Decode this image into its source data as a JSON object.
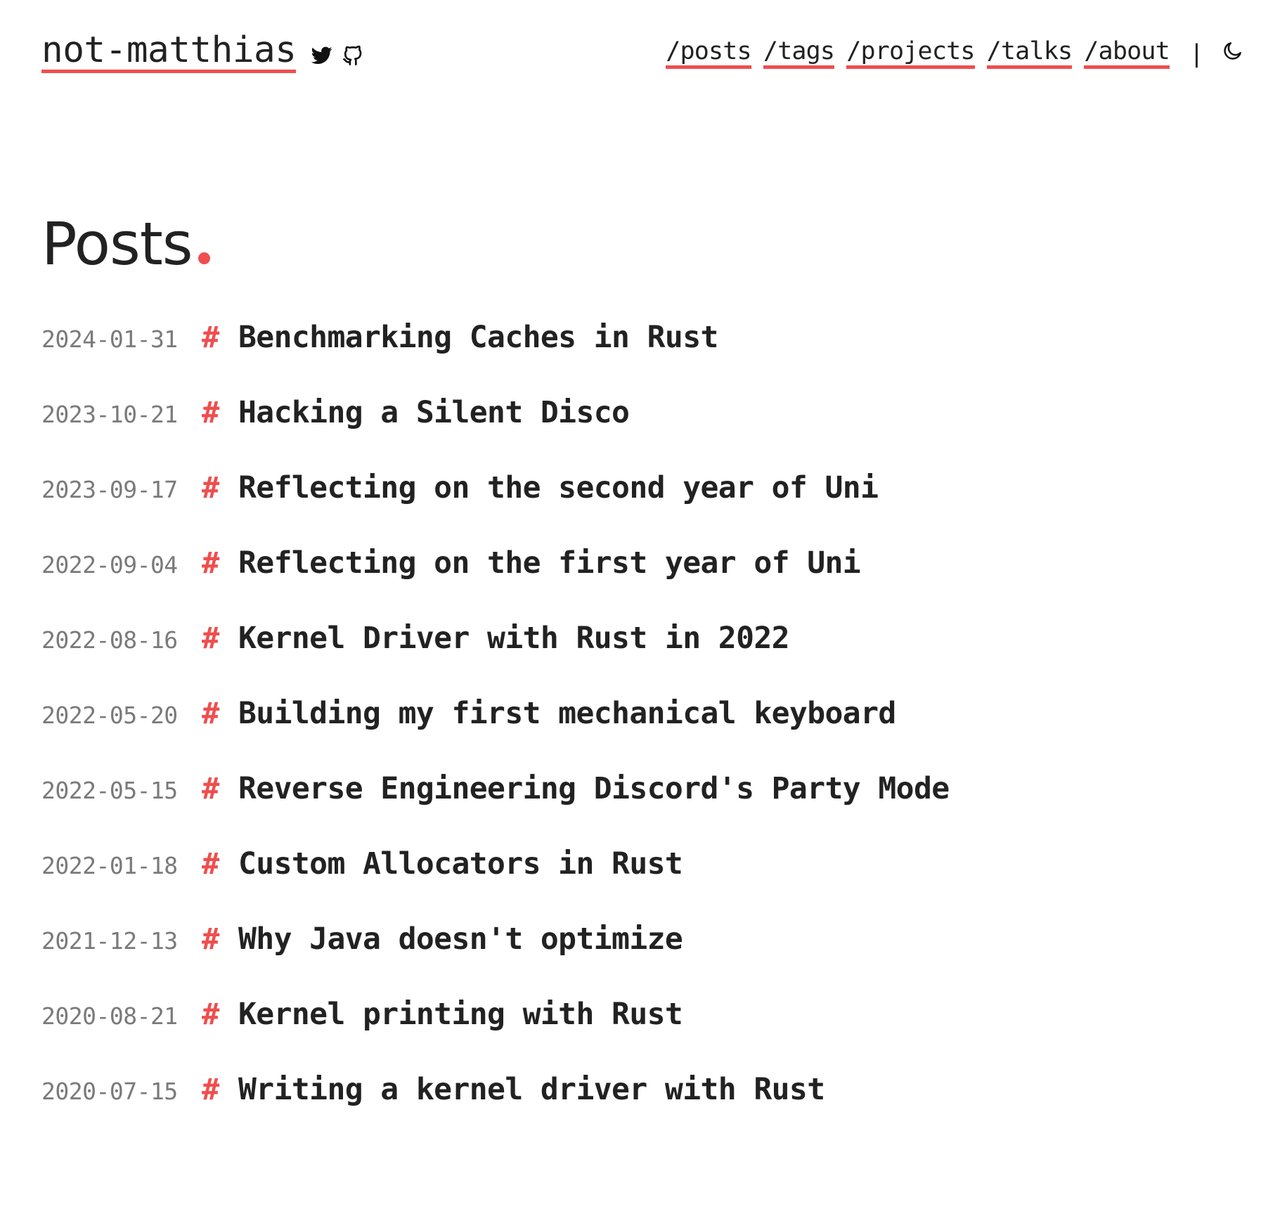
{
  "header": {
    "site_title": "not-matthias",
    "social": [
      {
        "icon": "twitter-icon"
      },
      {
        "icon": "github-icon"
      }
    ],
    "nav": [
      "/posts",
      "/tags",
      "/projects",
      "/talks",
      "/about"
    ],
    "separator": "|",
    "theme_toggle_icon": "moon-icon"
  },
  "main": {
    "heading": "Posts",
    "posts": [
      {
        "date": "2024-01-31",
        "hash": "#",
        "title": "Benchmarking Caches in Rust"
      },
      {
        "date": "2023-10-21",
        "hash": "#",
        "title": "Hacking a Silent Disco"
      },
      {
        "date": "2023-09-17",
        "hash": "#",
        "title": "Reflecting on the second year of Uni"
      },
      {
        "date": "2022-09-04",
        "hash": "#",
        "title": "Reflecting on the first year of Uni"
      },
      {
        "date": "2022-08-16",
        "hash": "#",
        "title": "Kernel Driver with Rust in 2022"
      },
      {
        "date": "2022-05-20",
        "hash": "#",
        "title": "Building my first mechanical keyboard"
      },
      {
        "date": "2022-05-15",
        "hash": "#",
        "title": "Reverse Engineering Discord's Party Mode"
      },
      {
        "date": "2022-01-18",
        "hash": "#",
        "title": "Custom Allocators in Rust"
      },
      {
        "date": "2021-12-13",
        "hash": "#",
        "title": "Why Java doesn't optimize"
      },
      {
        "date": "2020-08-21",
        "hash": "#",
        "title": "Kernel printing with Rust"
      },
      {
        "date": "2020-07-15",
        "hash": "#",
        "title": "Writing a kernel driver with Rust"
      }
    ]
  },
  "colors": {
    "accent": "#ef4e4e",
    "text": "#222222",
    "muted": "#7a7a7a",
    "background": "#ffffff"
  }
}
